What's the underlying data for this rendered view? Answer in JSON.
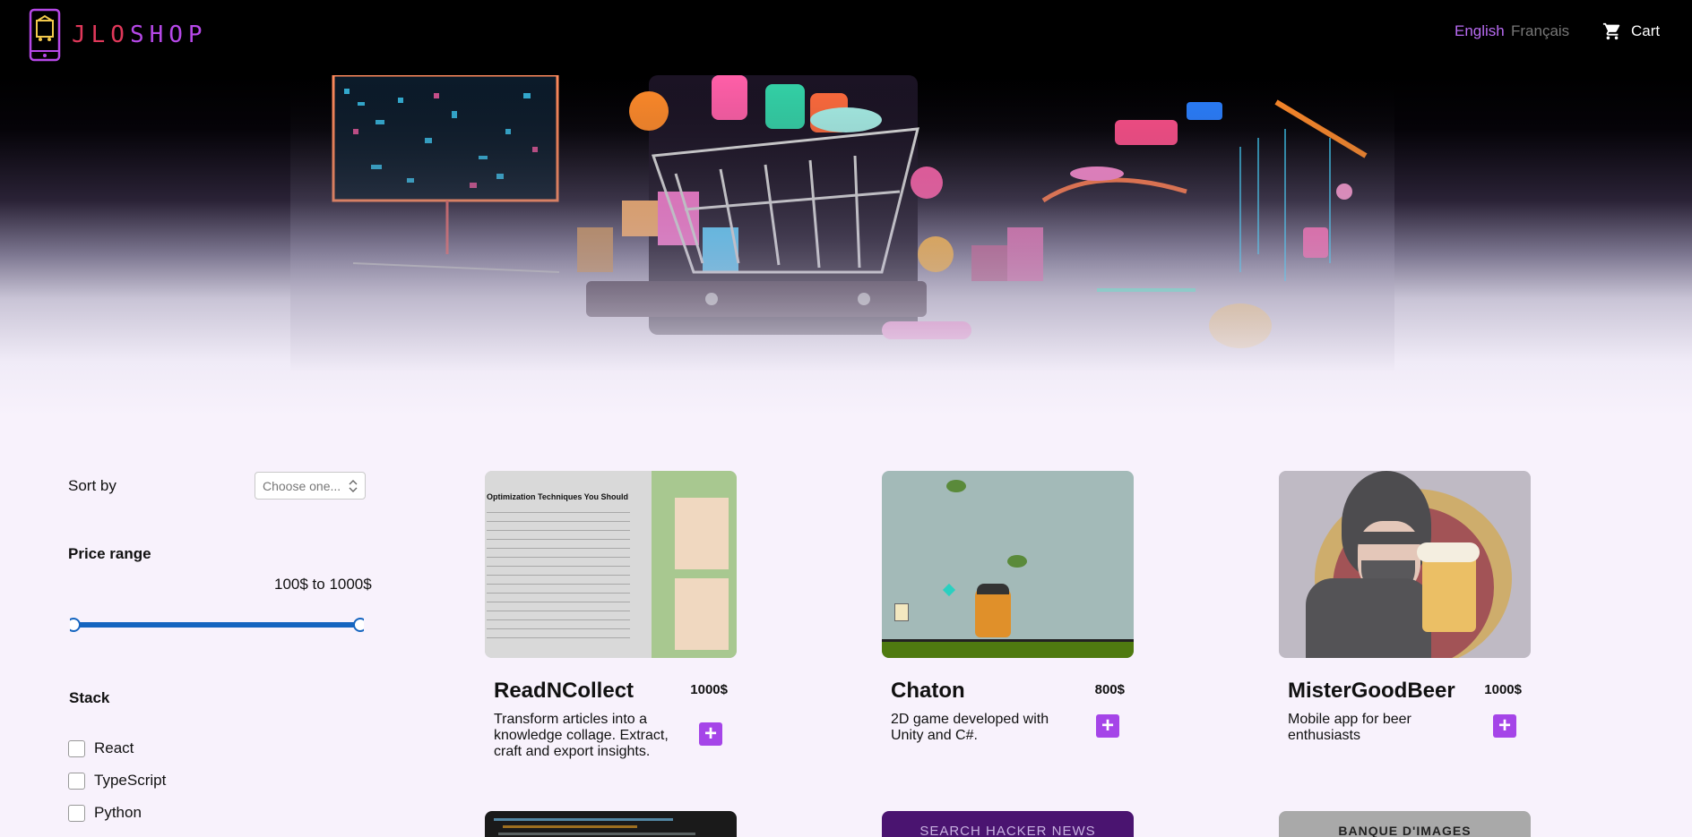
{
  "header": {
    "brand_part1": "JLO",
    "brand_part2": "SHOP",
    "lang_en": "English",
    "lang_fr": "Français",
    "cart_label": "Cart",
    "cart_icon": "shopping-cart-icon",
    "logo_icon": "phone-shop-logo-icon"
  },
  "filters": {
    "sort_label": "Sort by",
    "sort_placeholder": "Choose one...",
    "price_title": "Price range",
    "price_value": "100$ to 1000$",
    "price_min_fraction": 0.0,
    "price_max_fraction": 1.0,
    "stack_title": "Stack",
    "stack_items": [
      "React",
      "TypeScript",
      "Python"
    ]
  },
  "products": [
    {
      "title": "ReadNCollect",
      "price": "1000$",
      "desc": "Transform articles into a knowledge collage. Extract, craft and export insights.",
      "image_title": "Optimization Techniques You Should"
    },
    {
      "title": "Chaton",
      "price": "800$",
      "desc": "2D game developed with Unity and C#."
    },
    {
      "title": "MisterGoodBeer",
      "price": "1000$",
      "desc": "Mobile app for beer enthusiasts"
    }
  ],
  "row2": {
    "card2_label": "SEARCH HACKER NEWS",
    "card3_label": "BANQUE D'IMAGES"
  },
  "colors": {
    "accent": "#a545e8",
    "background": "#f8f2fc",
    "header": "#000000",
    "slider": "#1565c0"
  }
}
